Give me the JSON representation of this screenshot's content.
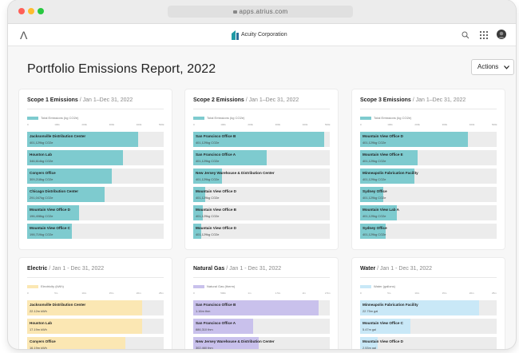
{
  "browser": {
    "url": "apps.atrius.com"
  },
  "app": {
    "logo": "Λ",
    "company": "Acuity Corporation"
  },
  "page": {
    "title": "Portfolio Emissions Report, 2022",
    "actions_label": "Actions"
  },
  "colors": {
    "teal": "#7ecbcf",
    "yellow": "#fbe7b3",
    "purple": "#c9c1ec",
    "blue": "#c9e8f7"
  },
  "cards": [
    {
      "title": "Scope 1 Emissions",
      "date": " / Jan 1–Dec 31, 2022",
      "legend": "Total Emissions (kg CO2e)",
      "color": "#7ecbcf",
      "ticks": [
        "0",
        "100k",
        "200k",
        "300k",
        "400k",
        "500k"
      ],
      "rows": [
        {
          "name": "Jacksonville Distribution Center",
          "value": "401,129kg CO2e",
          "fraction": 0.81
        },
        {
          "name": "Houston Lab",
          "value": "346,614kg CO2e",
          "fraction": 0.7
        },
        {
          "name": "Conyers Office",
          "value": "309,218kg CO2e",
          "fraction": 0.62
        },
        {
          "name": "Chicago Distribution Center",
          "value": "291,047kg CO2e",
          "fraction": 0.57
        },
        {
          "name": "Mountain View Office D",
          "value": "196,408kg CO2e",
          "fraction": 0.38
        },
        {
          "name": "Mountain View Office C",
          "value": "198,719kg CO2e",
          "fraction": 0.33
        }
      ]
    },
    {
      "title": "Scope 2 Emissions",
      "date": " / Jan 1–Dec 31, 2022",
      "legend": "Total Emissions (kg CO2e)",
      "color": "#7ecbcf",
      "ticks": [
        "0",
        "100k",
        "200k",
        "300k",
        "400k",
        "500k"
      ],
      "rows": [
        {
          "name": "San Francisco Office B",
          "value": "401,129kg CO2e",
          "fraction": 0.96
        },
        {
          "name": "San Francisco Office A",
          "value": "401,129kg CO2e",
          "fraction": 0.54
        },
        {
          "name": "New Jersey Warehouse & Distribution Center",
          "value": "401,129kg CO2e",
          "fraction": 0.21
        },
        {
          "name": "Mountain View Office D",
          "value": "401,129kg CO2e",
          "fraction": 0.09
        },
        {
          "name": "Mountain View Office B",
          "value": "401,129kg CO2e",
          "fraction": 0.07
        },
        {
          "name": "Mountain View Office D",
          "value": "401,129kg CO2e",
          "fraction": 0.06
        }
      ]
    },
    {
      "title": "Scope 3 Emissions",
      "date": " / Jan 1–Dec 31, 2022",
      "legend": "Total Emissions (kg CO2e)",
      "color": "#7ecbcf",
      "ticks": [
        "0",
        "100k",
        "200k",
        "300k",
        "400k",
        "500k"
      ],
      "rows": [
        {
          "name": "Mountain View Office D",
          "value": "401,129kg CO2e",
          "fraction": 0.79
        },
        {
          "name": "Mountain View Office E",
          "value": "401,129kg CO2e",
          "fraction": 0.42
        },
        {
          "name": "Minneapolis Fabrication Facility",
          "value": "401,129kg CO2e",
          "fraction": 0.4
        },
        {
          "name": "Sydney Office",
          "value": "401,129kg CO2e",
          "fraction": 0.17
        },
        {
          "name": "Mountain View Lab A",
          "value": "401,129kg CO2e",
          "fraction": 0.27
        },
        {
          "name": "Sydney Office",
          "value": "401,129kg CO2e",
          "fraction": 0.19
        }
      ]
    },
    {
      "title": "Electric",
      "date": " / Jan 1 - Dec 31, 2022",
      "legend": "Electricity (kWh)",
      "color": "#fbe7b3",
      "ticks": [
        "0",
        "5m",
        "10m",
        "15m",
        "20m",
        "25m"
      ],
      "rows": [
        {
          "name": "Jacksonville Distribution Center",
          "value": "22.12m kWh",
          "fraction": 0.84
        },
        {
          "name": "Houston Lab",
          "value": "17.19m kWh",
          "fraction": 0.84
        },
        {
          "name": "Conyers Office",
          "value": "16.19m kWh",
          "fraction": 0.72
        }
      ]
    },
    {
      "title": "Natural Gas",
      "date": " / Jan 1 - Dec 31, 2022",
      "legend": "Natural Gas (therm)",
      "color": "#c9c1ec",
      "ticks": [
        "0",
        "500k",
        "1m",
        "1.5m",
        "2m",
        "2.5m"
      ],
      "rows": [
        {
          "name": "San Francisco Office B",
          "value": "1.16m thm",
          "fraction": 0.92
        },
        {
          "name": "San Francisco Office A",
          "value": "886,310 thm",
          "fraction": 0.44
        },
        {
          "name": "New Jersey Warehouse & Distribution Center",
          "value": "302,460 thm",
          "fraction": 0.48
        }
      ]
    },
    {
      "title": "Water",
      "date": " / Jan 1 - Dec 31, 2022",
      "legend": "Water (gallons)",
      "color": "#c9e8f7",
      "ticks": [
        "0",
        "5m",
        "10m",
        "15m",
        "20m",
        "25m"
      ],
      "rows": [
        {
          "name": "Minneapolis Fabrication Facility",
          "value": "22.75m gal",
          "fraction": 0.87
        },
        {
          "name": "Mountain View Office C",
          "value": "5.47m gal",
          "fraction": 0.37
        },
        {
          "name": "Mountain View Office D",
          "value": "2.53m gal",
          "fraction": 0.13
        }
      ]
    }
  ]
}
